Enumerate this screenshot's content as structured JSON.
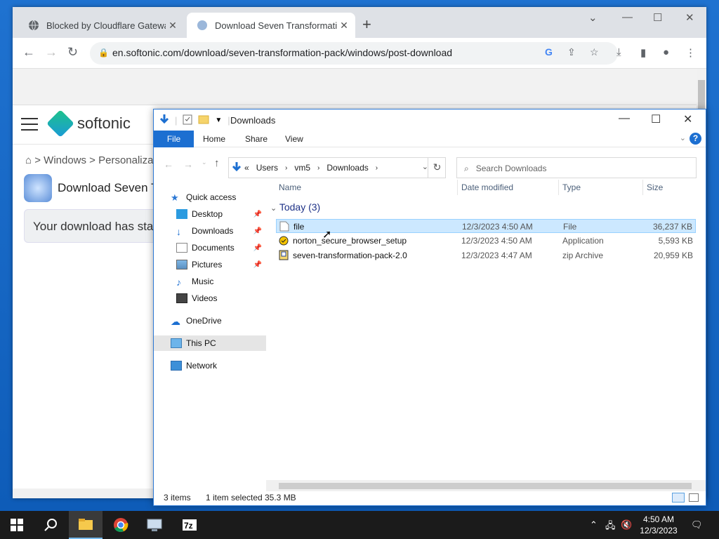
{
  "browser": {
    "tabs": [
      {
        "title": "Blocked by Cloudflare Gateway"
      },
      {
        "title": "Download Seven Transformation"
      }
    ],
    "url": "en.softonic.com/download/seven-transformation-pack/windows/post-download"
  },
  "site": {
    "logo": "softonic",
    "breadcrumb": "> Windows > Personaliza",
    "download_title": "Download Seven T",
    "notice": "Your download has sta"
  },
  "explorer": {
    "title": "Downloads",
    "ribbon": {
      "file": "File",
      "home": "Home",
      "share": "Share",
      "view": "View"
    },
    "address": {
      "prefix": "«",
      "segments": [
        "Users",
        "vm5",
        "Downloads"
      ]
    },
    "search_placeholder": "Search Downloads",
    "nav": {
      "quick_access": "Quick access",
      "desktop": "Desktop",
      "downloads": "Downloads",
      "documents": "Documents",
      "pictures": "Pictures",
      "music": "Music",
      "videos": "Videos",
      "onedrive": "OneDrive",
      "this_pc": "This PC",
      "network": "Network"
    },
    "columns": {
      "name": "Name",
      "date": "Date modified",
      "type": "Type",
      "size": "Size"
    },
    "group": "Today (3)",
    "files": [
      {
        "name": "file",
        "date": "12/3/2023 4:50 AM",
        "type": "File",
        "size": "36,237 KB"
      },
      {
        "name": "norton_secure_browser_setup",
        "date": "12/3/2023 4:50 AM",
        "type": "Application",
        "size": "5,593 KB"
      },
      {
        "name": "seven-transformation-pack-2.0",
        "date": "12/3/2023 4:47 AM",
        "type": "zip Archive",
        "size": "20,959 KB"
      }
    ],
    "status": {
      "items": "3 items",
      "selected": "1 item selected",
      "size": "35.3 MB"
    }
  },
  "taskbar": {
    "time": "4:50 AM",
    "date": "12/3/2023"
  },
  "colors": {
    "accent": "#1c6fd1",
    "selection": "#cce8ff"
  }
}
